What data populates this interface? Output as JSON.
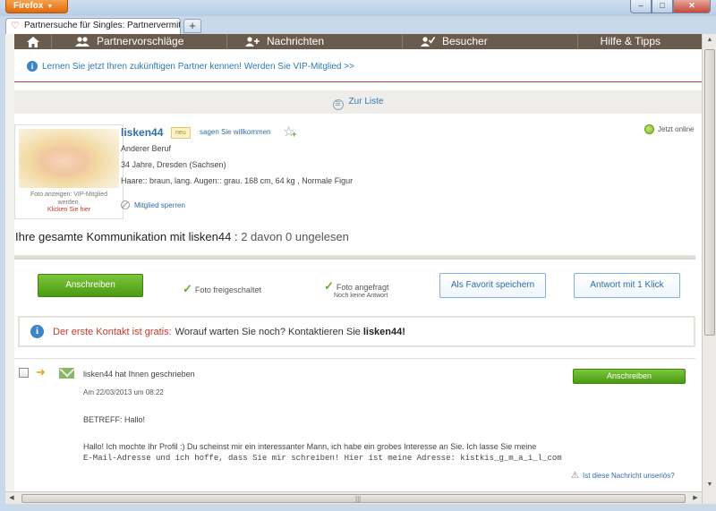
{
  "browser": {
    "app_button": "Firefox",
    "tab_title": "Partnersuche für Singles: Partnervermittl...",
    "new_tab": "+",
    "win_min": "–",
    "win_max": "□",
    "win_close": "✕"
  },
  "nav": {
    "items": [
      {
        "label": "Partnervorschläge",
        "icon": "people-icon"
      },
      {
        "label": "Nachrichten",
        "icon": "person-add-icon"
      },
      {
        "label": "Besucher",
        "icon": "person-check-icon"
      },
      {
        "label": "Hilfe & Tipps"
      }
    ]
  },
  "vip_banner": "Lernen Sie jetzt Ihren zukünftigen Partner kennen! Werden Sie VIP-Mitglied >>",
  "back_to_list": "Zur Liste",
  "profile": {
    "photo_caption": "Foto anzeigen: VIP-Mitglied werden.",
    "photo_link": "Klicken Sie hier",
    "username": "lisken44",
    "badge": "neu",
    "welcome_link": "sagen Sie willkommen",
    "job": "Anderer Beruf",
    "age_city": "34 Jahre, Dresden (Sachsen)",
    "details": "Haare:: braun, lang. Augen:: grau. 168 cm, 64 kg , Normale Figur",
    "block_link": "Mitglied sperren",
    "online_status": "Jetzt online"
  },
  "communication": {
    "title": "Ihre gesamte Kommunikation mit lisken44 :",
    "summary": "2 davon 0 ungelesen"
  },
  "actions": {
    "write": "Anschreiben",
    "photo_unlocked": "Foto freigeschaltet",
    "photo_requested": "Foto angefragt",
    "no_reply": "Noch keine Antwort",
    "save_favorite": "Als Favorit speichern",
    "reply_one_click": "Antwort mit 1 Klick"
  },
  "gratis": {
    "red": "Der erste Kontakt ist gratis:",
    "text": "Worauf warten Sie noch? Kontaktieren Sie",
    "name": "lisken44!"
  },
  "message": {
    "from": "lisken44 hat Ihnen geschrieben",
    "date": "Am 22/03/2013 um 08:22",
    "reply_button": "Anschreiben",
    "subject": "BETREFF: Hallo!",
    "body_line1": "Hallo! Ich mochte Ihr Profil :) Du scheinst mir ein interessanter Mann, ich habe ein grobes Interesse an Sie. Ich lasse Sie meine",
    "body_line2": "E-Mail-Adresse und ich hoffe, dass Sie mir schreiben! Hier ist meine Adresse: kistkis_g_m_a_i_l_com",
    "report_link": "Ist diese Nachricht unseriös?"
  }
}
